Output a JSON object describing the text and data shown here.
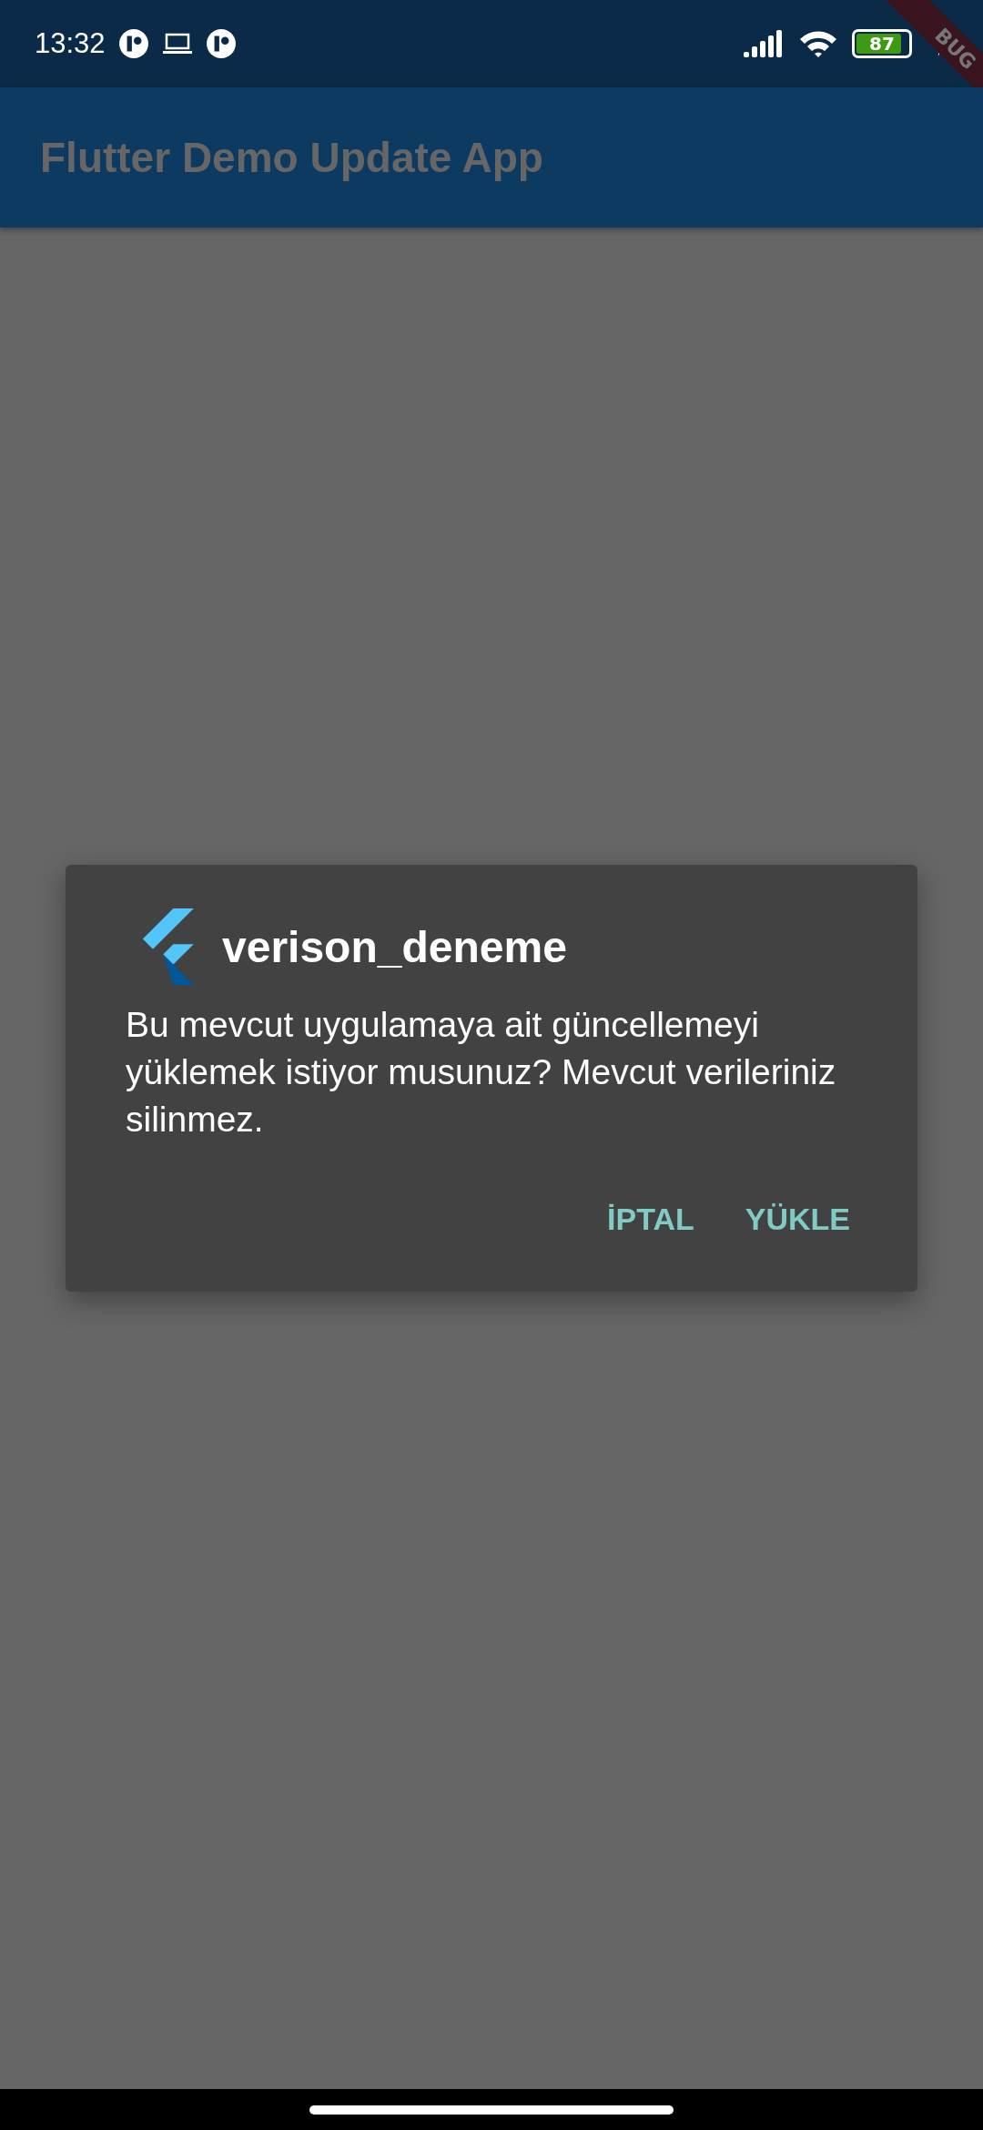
{
  "status_bar": {
    "time": "13:32",
    "battery": {
      "text": "87",
      "level": 0.87
    }
  },
  "debug_banner": "BUG",
  "app_bar": {
    "title": "Flutter Demo Update App"
  },
  "dialog": {
    "title": "verison_deneme",
    "message": "Bu mevcut uygulamaya ait güncellemeyi yüklemek istiyor musunuz? Mevcut verileriniz silinmez.",
    "buttons": [
      "İPTAL",
      "YÜKLE"
    ]
  }
}
